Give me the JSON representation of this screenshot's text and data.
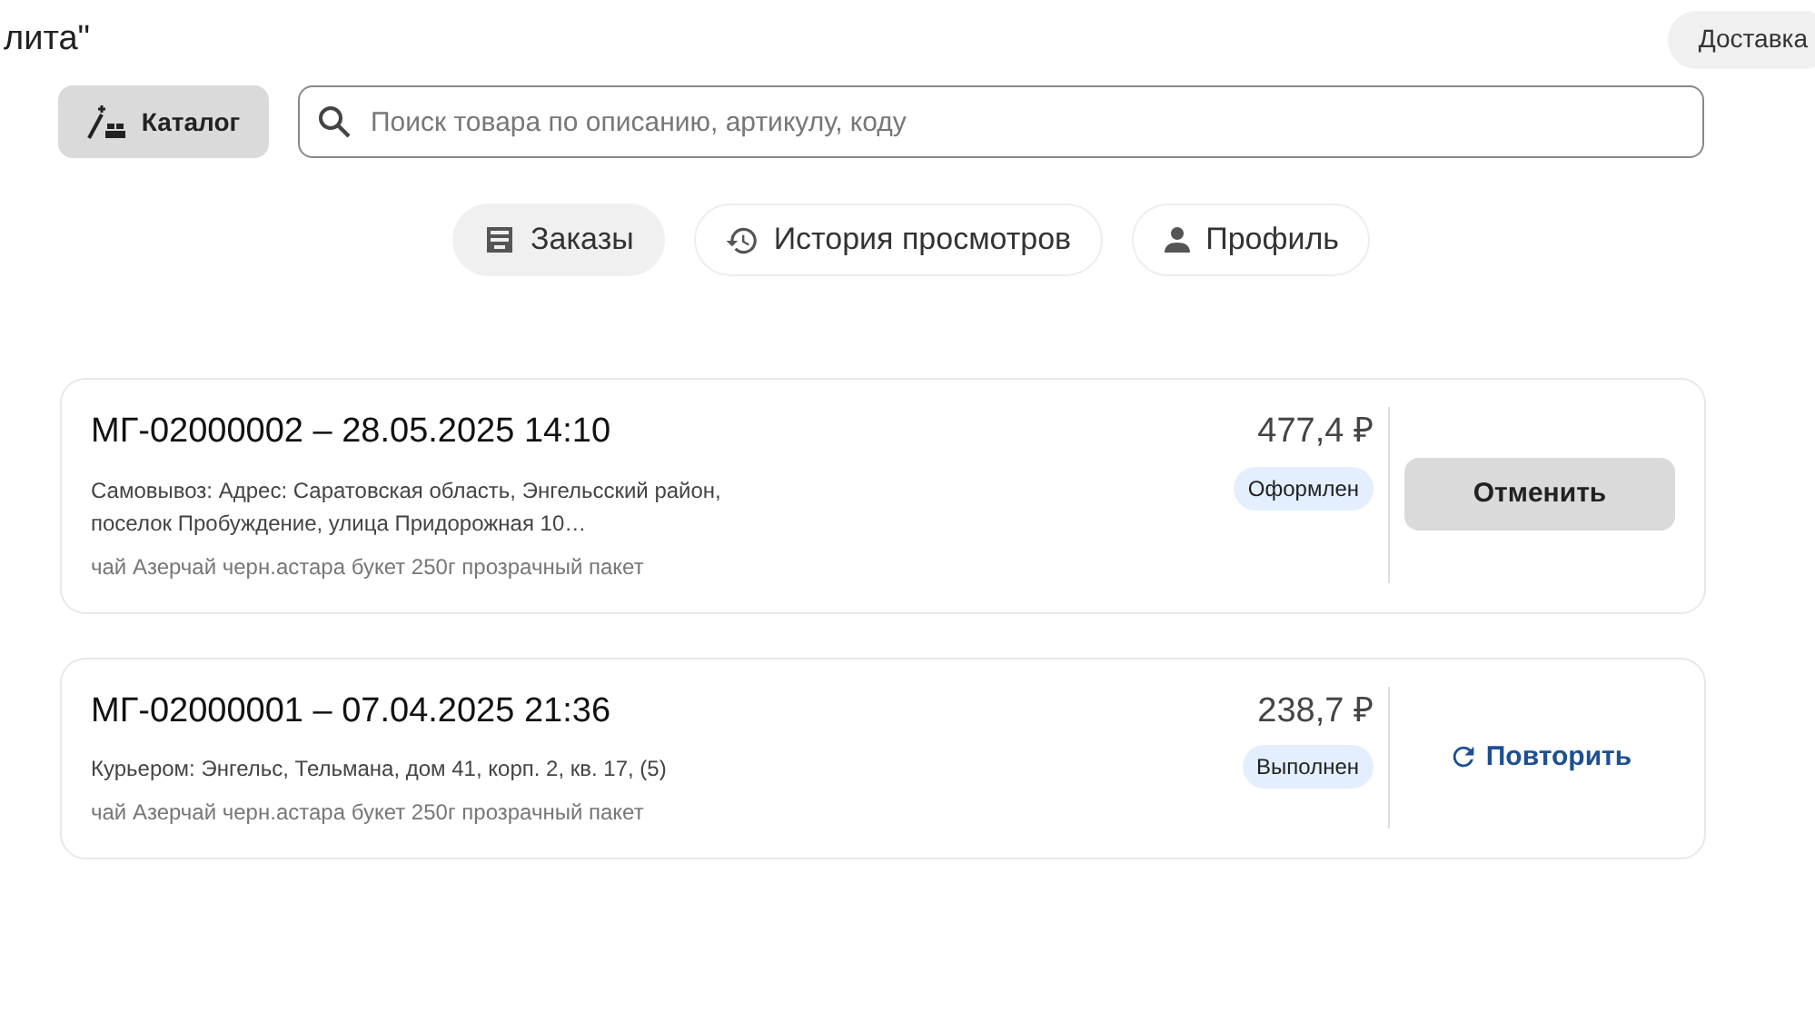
{
  "header": {
    "title": "лита\"",
    "delivery": "Доставка"
  },
  "catalog_button": "Каталог",
  "search": {
    "placeholder": "Поиск товара по описанию, артикулу, коду"
  },
  "tabs": [
    {
      "label": "Заказы",
      "kind": "orders",
      "selected": true
    },
    {
      "label": "История просмотров",
      "kind": "history",
      "selected": false
    },
    {
      "label": "Профиль",
      "kind": "profile",
      "selected": false
    }
  ],
  "orders": [
    {
      "title": "МГ-02000002 – 28.05.2025 14:10",
      "address": "Самовывоз: Адрес: Саратовская область, Энгельсский район, поселок Пробуждение, улица Придорожная 10…",
      "items": "чай Азерчай черн.астара букет 250г прозрачный пакет",
      "total": "477,4 ₽",
      "status": "Оформлен",
      "action": {
        "kind": "cancel",
        "label": "Отменить"
      }
    },
    {
      "title": "МГ-02000001 – 07.04.2025 21:36",
      "address": "Курьером: Энгельс, Тельмана, дом 41, корп. 2, кв. 17, (5)",
      "items": "чай Азерчай черн.астара букет 250г прозрачный пакет",
      "total": "238,7 ₽",
      "status": "Выполнен",
      "action": {
        "kind": "repeat",
        "label": "Повторить"
      }
    }
  ]
}
